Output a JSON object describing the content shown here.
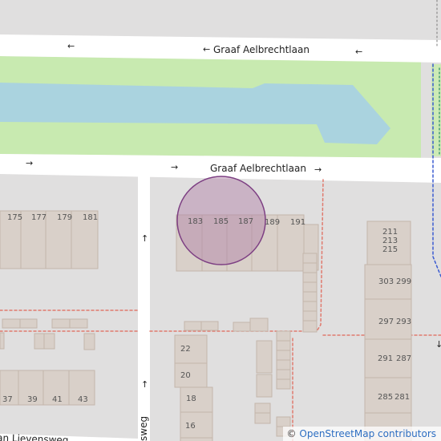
{
  "map": {
    "street_top": "Graaf Aelbrechtlaan",
    "street_middle": "Graaf Aelbrechtlaan",
    "street_bottom_left": "an Lievensweg",
    "street_vertical": "sweg",
    "oneway_arrow_left": "←",
    "oneway_arrow_right": "→",
    "oneway_arrow_up": "↑",
    "oneway_arrow_down": "↓",
    "house_numbers": {
      "n175": "175",
      "n177": "177",
      "n179": "179",
      "n181": "181",
      "n183": "183",
      "n185": "185",
      "n187": "187",
      "n189": "189",
      "n191": "191",
      "n211": "211",
      "n213": "213",
      "n215": "215",
      "n303": "303",
      "n299": "299",
      "n297": "297",
      "n293": "293",
      "n291": "291",
      "n287": "287",
      "n285": "285",
      "n281": "281",
      "n22": "22",
      "n20": "20",
      "n18": "18",
      "n16": "16",
      "n37": "37",
      "n39": "39",
      "n41": "41",
      "n43": "43"
    },
    "colors": {
      "background": "#e0dfdf",
      "park": "#c8eab0",
      "water": "#aad3df",
      "building": "#d9d0c9",
      "building_outline": "#c4b6ab",
      "road": "#ffffff",
      "marker_fill": "#b07fa6",
      "marker_stroke": "#7d3f83"
    }
  },
  "attribution": {
    "symbol": "©",
    "text": "OpenStreetMap contributors"
  }
}
